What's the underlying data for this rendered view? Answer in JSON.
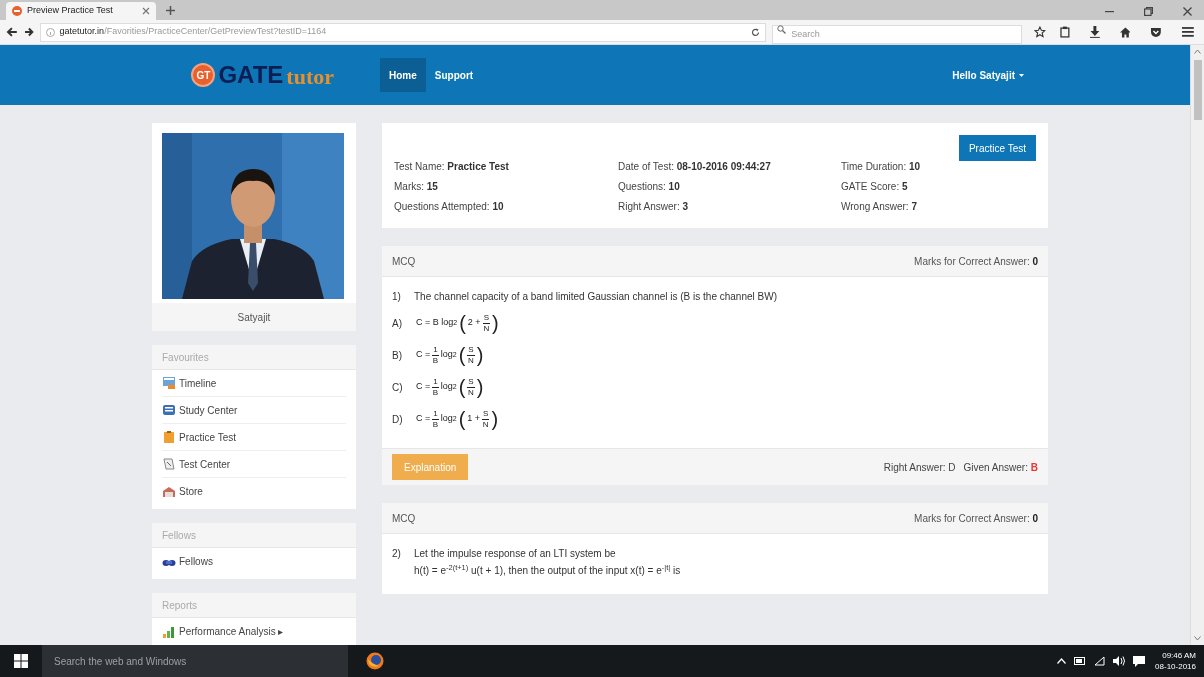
{
  "browser": {
    "tab_title": "Preview Practice Test",
    "url_host": "gatetutor.in",
    "url_path": "/Favorities/PracticeCenter/GetPreviewTest?testID=1164",
    "search_placeholder": "Search"
  },
  "navbar": {
    "logo_badge": "GT",
    "logo_main": "GATE",
    "logo_accent": "tutor",
    "links": [
      {
        "label": "Home",
        "selected": true
      },
      {
        "label": "Support",
        "selected": false
      }
    ],
    "user_menu": "Hello Satyajit"
  },
  "profile": {
    "name": "Satyajit"
  },
  "sidebar_sections": [
    {
      "title": "Favourites",
      "items": [
        {
          "label": "Timeline",
          "kind": "timeline"
        },
        {
          "label": "Study Center",
          "kind": "study"
        },
        {
          "label": "Practice Test",
          "kind": "practice"
        },
        {
          "label": "Test Center",
          "kind": "test"
        },
        {
          "label": "Store",
          "kind": "store"
        }
      ]
    },
    {
      "title": "Fellows",
      "items": [
        {
          "label": "Fellows",
          "kind": "fellows"
        }
      ]
    },
    {
      "title": "Reports",
      "items": [
        {
          "label": "Performance Analysis ▸",
          "kind": "chart"
        }
      ]
    }
  ],
  "summary": {
    "button": "Practice Test",
    "fields": [
      {
        "label": "Test Name:",
        "value": "Practice Test"
      },
      {
        "label": "Date of Test:",
        "value": "08-10-2016 09:44:27"
      },
      {
        "label": "Time Duration:",
        "value": "10"
      },
      {
        "label": "Marks:",
        "value": "15"
      },
      {
        "label": "Questions:",
        "value": "10"
      },
      {
        "label": "GATE Score:",
        "value": "5"
      },
      {
        "label": "Questions Attempted:",
        "value": "10"
      },
      {
        "label": "Right Answer:",
        "value": "3"
      },
      {
        "label": "Wrong Answer:",
        "value": "7"
      }
    ]
  },
  "questions": [
    {
      "type_label": "MCQ",
      "marks_label": "Marks for Correct Answer:",
      "marks": "0",
      "number": "1)",
      "text": [
        "The channel capacity of a band limited Gaussian channel is (B is the channel BW)"
      ],
      "options": [
        {
          "letter": "A)",
          "formula": [
            {
              "kind": "text",
              "text": "C = B log"
            },
            {
              "kind": "sub",
              "text": "2"
            },
            {
              "kind": "paren",
              "text": "("
            },
            {
              "kind": "text",
              "text": "2 +"
            },
            {
              "kind": "frac",
              "num": "S",
              "den": "N"
            },
            {
              "kind": "paren",
              "text": ")"
            }
          ]
        },
        {
          "letter": "B)",
          "formula": [
            {
              "kind": "text",
              "text": "C ="
            },
            {
              "kind": "frac",
              "num": "1",
              "den": "B"
            },
            {
              "kind": "text",
              "text": "log"
            },
            {
              "kind": "sub",
              "text": "2"
            },
            {
              "kind": "paren",
              "text": "("
            },
            {
              "kind": "frac",
              "num": "S",
              "den": "N"
            },
            {
              "kind": "paren",
              "text": ")"
            }
          ]
        },
        {
          "letter": "C)",
          "formula": [
            {
              "kind": "text",
              "text": "C ="
            },
            {
              "kind": "frac",
              "num": "1",
              "den": "B"
            },
            {
              "kind": "text",
              "text": "log"
            },
            {
              "kind": "sub",
              "text": "2"
            },
            {
              "kind": "paren",
              "text": "("
            },
            {
              "kind": "frac",
              "num": "S",
              "den": "N"
            },
            {
              "kind": "paren",
              "text": ")"
            }
          ]
        },
        {
          "letter": "D)",
          "formula": [
            {
              "kind": "text",
              "text": "C ="
            },
            {
              "kind": "frac",
              "num": "1",
              "den": "B"
            },
            {
              "kind": "text",
              "text": "log"
            },
            {
              "kind": "sub",
              "text": "2"
            },
            {
              "kind": "paren",
              "text": "("
            },
            {
              "kind": "text",
              "text": "1 +"
            },
            {
              "kind": "frac",
              "num": "S",
              "den": "N"
            },
            {
              "kind": "paren",
              "text": ")"
            }
          ]
        }
      ],
      "explanation_button": "Explanation",
      "right_answer_label": "Right Answer:",
      "right_answer": "D",
      "given_answer_label": "Given Answer:",
      "given_answer": "B",
      "given_correct": false
    },
    {
      "type_label": "MCQ",
      "marks_label": "Marks for Correct Answer:",
      "marks": "0",
      "number": "2)",
      "text": [
        "Let the impulse response of an LTI system be",
        "h(t) = e$^{-2(t+1)}$ u(t + 1), then the output of the input x(t) = e$^{-|t|}$ is"
      ]
    }
  ],
  "taskbar": {
    "search_placeholder": "Search the web and Windows",
    "time": "09:46 AM",
    "date": "08-10-2016"
  }
}
